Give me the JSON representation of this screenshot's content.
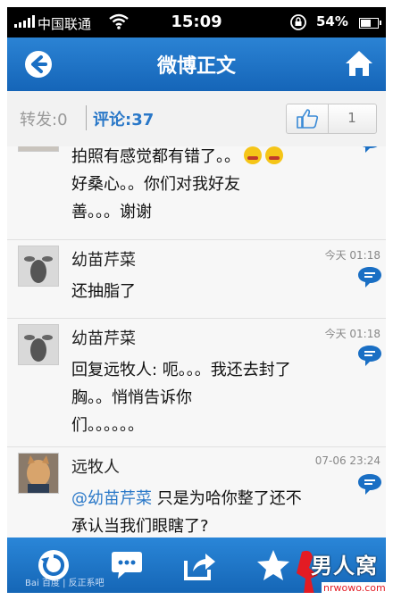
{
  "status_bar": {
    "carrier": "中国联通",
    "time": "15:09",
    "battery_pct_text": "54%",
    "battery_level": 0.54
  },
  "navbar": {
    "title": "微博正文",
    "back_icon": "back-arrow-icon",
    "home_icon": "home-icon"
  },
  "tabs": {
    "forward_label": "转发:0",
    "comment_label": "评论:37",
    "like_count": "1"
  },
  "comments": [
    {
      "name": "",
      "time": "",
      "lines": [
        "拍照有感觉都有错了。。",
        "好桑心。。你们对我好友",
        "善。。。谢谢"
      ]
    },
    {
      "name": "幼苗芹菜",
      "time": "今天 01:18",
      "lines": [
        "还抽脂了"
      ]
    },
    {
      "name": "幼苗芹菜",
      "time": "今天 01:18",
      "lines": [
        "回复远牧人: 呃。。。我还去封了",
        "胸。。悄悄告诉你",
        "们。。。。。。"
      ]
    },
    {
      "name": "远牧人",
      "time": "07-06 23:24",
      "mention": "@幼苗芹菜",
      "line1_rest": " 只是为哈你整了还不",
      "line2": "承认当我们眼瞎了?"
    }
  ],
  "toolbar": {
    "icons": [
      "refresh-icon",
      "comment-icon",
      "share-icon",
      "favorite-star-icon"
    ]
  },
  "watermarks": {
    "baidu": "Bai 百度 | 反正系吧",
    "site_cn": "男人窝",
    "site_url": "nrwowo.com"
  },
  "colors": {
    "accent": "#1a6fc4",
    "link": "#2a78c8",
    "status_bg": "#000000"
  }
}
